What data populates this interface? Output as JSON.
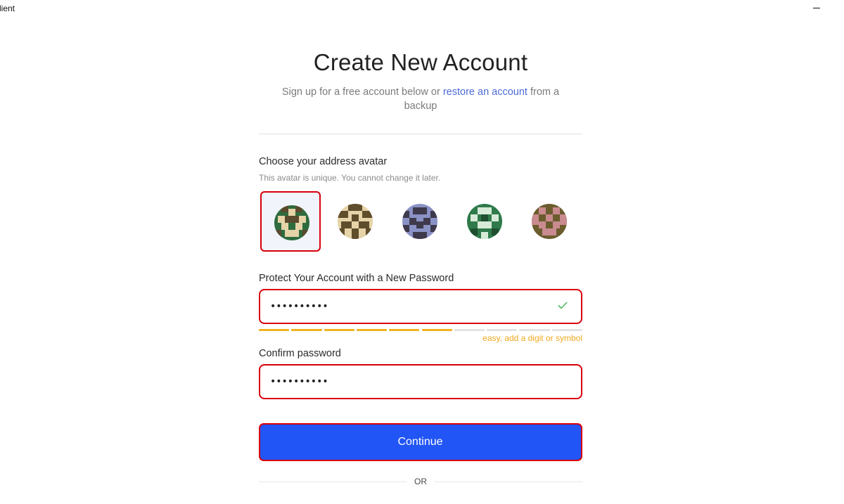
{
  "window": {
    "title": "lient"
  },
  "heading": "Create New Account",
  "subtitle": {
    "before": "Sign up for a free account below or ",
    "link": "restore an account",
    "after": " from a backup"
  },
  "avatar": {
    "label": "Choose your address avatar",
    "hint": "This avatar is unique. You cannot change it later.",
    "selected_index": 0,
    "options": [
      {
        "name": "avatar-green-beige"
      },
      {
        "name": "avatar-brown-beige"
      },
      {
        "name": "avatar-slate-blue"
      },
      {
        "name": "avatar-green-white"
      },
      {
        "name": "avatar-olive-pink"
      }
    ]
  },
  "password": {
    "label": "Protect Your Account with a New Password",
    "value": "••••••••••",
    "strength_filled": 6,
    "strength_total": 10,
    "strength_text": "easy, add a digit or symbol"
  },
  "confirm": {
    "label": "Confirm password",
    "value": "••••••••••"
  },
  "continue_label": "Continue",
  "or_label": "OR",
  "colors": {
    "accent": "#2255f5",
    "link": "#4d6bd8",
    "highlight": "#d8000a",
    "strength_filled": "#f0b31e",
    "strength_empty": "#e3e3e3",
    "check": "#4cbb5c"
  }
}
